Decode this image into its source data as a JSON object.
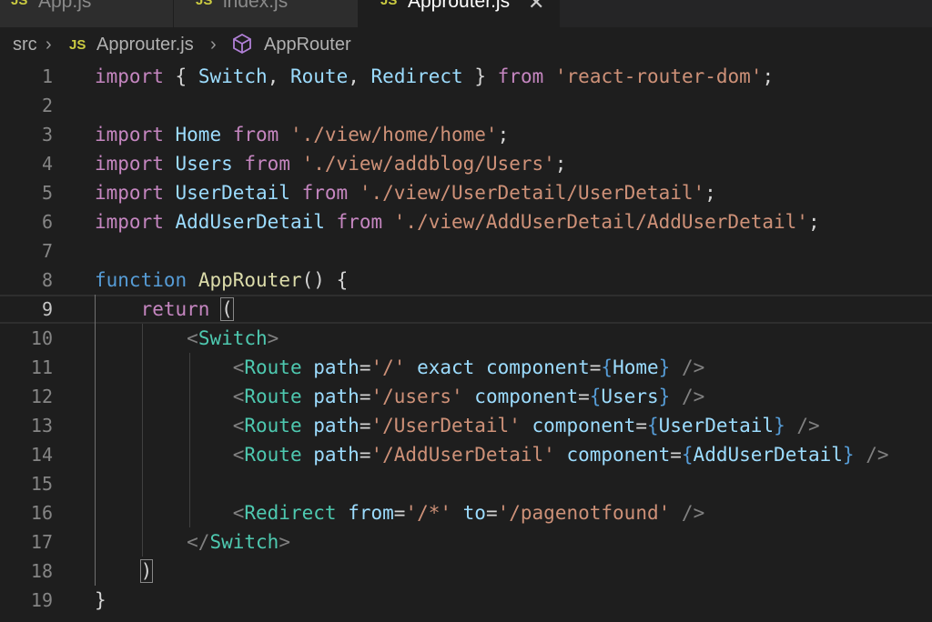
{
  "tabs": [
    {
      "icon": "JS",
      "label": "App.js",
      "active": false
    },
    {
      "icon": "JS",
      "label": "index.js",
      "active": false
    },
    {
      "icon": "JS",
      "label": "Approuter.js",
      "active": true,
      "close": "✕"
    }
  ],
  "breadcrumb": {
    "folder": "src",
    "separator": "›",
    "file_icon": "JS",
    "file": "Approuter.js",
    "symbol_icon": "cube-icon",
    "symbol": "AppRouter"
  },
  "editor": {
    "language": "javascript",
    "current_line": 9,
    "lines": [
      {
        "n": "1",
        "text": "import { Switch, Route, Redirect } from 'react-router-dom';"
      },
      {
        "n": "2",
        "text": ""
      },
      {
        "n": "3",
        "text": "import Home from './view/home/home';"
      },
      {
        "n": "4",
        "text": "import Users from './view/addblog/Users';"
      },
      {
        "n": "5",
        "text": "import UserDetail from './view/UserDetail/UserDetail';"
      },
      {
        "n": "6",
        "text": "import AddUserDetail from './view/AddUserDetail/AddUserDetail';"
      },
      {
        "n": "7",
        "text": ""
      },
      {
        "n": "8",
        "text": "function AppRouter() {"
      },
      {
        "n": "9",
        "text": "    return ("
      },
      {
        "n": "10",
        "text": "        <Switch>"
      },
      {
        "n": "11",
        "text": "            <Route path='/' exact component={Home} />"
      },
      {
        "n": "12",
        "text": "            <Route path='/users' component={Users} />"
      },
      {
        "n": "13",
        "text": "            <Route path='/UserDetail' component={UserDetail} />"
      },
      {
        "n": "14",
        "text": "            <Route path='/AddUserDetail' component={AddUserDetail} />"
      },
      {
        "n": "15",
        "text": ""
      },
      {
        "n": "16",
        "text": "            <Redirect from='/*' to='/pagenotfound' />"
      },
      {
        "n": "17",
        "text": "        </Switch>"
      },
      {
        "n": "18",
        "text": "    )"
      },
      {
        "n": "19",
        "text": "}"
      }
    ]
  },
  "colors": {
    "background": "#1e1e1e",
    "keyword_control": "#c586c0",
    "keyword": "#569cd6",
    "variable": "#9cdcfe",
    "function": "#dcdcaa",
    "string": "#ce9178",
    "tag": "#4ec9b0",
    "js_icon": "#cbcb41"
  }
}
